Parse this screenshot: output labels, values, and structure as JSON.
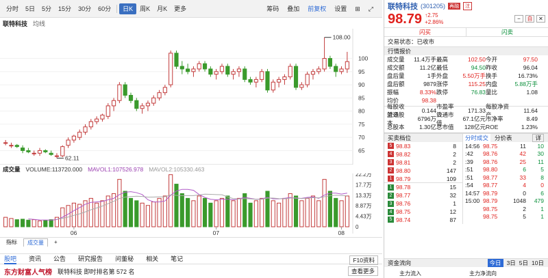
{
  "toolbar": {
    "items": [
      "分时",
      "5日",
      "5分",
      "15分",
      "30分",
      "60分",
      "日K",
      "周K",
      "月K",
      "更多"
    ],
    "active": "日K",
    "right": [
      "筹码",
      "叠加",
      "前复权",
      "设置"
    ]
  },
  "stock": {
    "name": "联特科技",
    "indicator": "均线",
    "code": "(301205)",
    "tag1": "再融",
    "tag2": "注",
    "price": "98.79",
    "change": "2.75",
    "pct": "+2.86%",
    "vol_label": "成交量"
  },
  "chart_data": {
    "type": "candlestick",
    "x_ticks": [
      "06",
      "07",
      "08"
    ],
    "y_ticks": [
      100,
      95,
      90,
      85,
      80,
      75,
      70,
      65
    ],
    "max_label": "108.00",
    "min_label": "62.11",
    "vol_ticks": [
      "22.2万",
      "17.7万",
      "13.3万",
      "8.87万",
      "4.43万",
      "0"
    ],
    "ohlc": [
      [
        68,
        69,
        67,
        68
      ],
      [
        67,
        68,
        66,
        67
      ],
      [
        67,
        67.5,
        66,
        66.5
      ],
      [
        66,
        67,
        64,
        65
      ],
      [
        65,
        66,
        64,
        64.5
      ],
      [
        64,
        65,
        63,
        64
      ],
      [
        64,
        66,
        63,
        65
      ],
      [
        65,
        65.5,
        64,
        64.5
      ],
      [
        64,
        65,
        63,
        63.5
      ],
      [
        63,
        64,
        62.11,
        63
      ],
      [
        63,
        67,
        62.5,
        66.5
      ],
      [
        67,
        70,
        66,
        69
      ],
      [
        69,
        71,
        68,
        70.5
      ],
      [
        70,
        73,
        69,
        72
      ],
      [
        72,
        75,
        71,
        74
      ],
      [
        74,
        77,
        73,
        76
      ],
      [
        76,
        78,
        75,
        77
      ],
      [
        77,
        79,
        76,
        78.5
      ],
      [
        78,
        83,
        77,
        82
      ],
      [
        82,
        85,
        80,
        84
      ],
      [
        84,
        91,
        83,
        90
      ],
      [
        90,
        91,
        85,
        86
      ],
      [
        86,
        87,
        83,
        84
      ],
      [
        84,
        85,
        80,
        81
      ],
      [
        81,
        83,
        79,
        82
      ],
      [
        82,
        84,
        80,
        83
      ],
      [
        83,
        86,
        82,
        85
      ],
      [
        85,
        88,
        84,
        87
      ],
      [
        87,
        90,
        86,
        89
      ],
      [
        90,
        103,
        89,
        102
      ],
      [
        102,
        103,
        96,
        97
      ],
      [
        97,
        99,
        94,
        96
      ],
      [
        96,
        98,
        94,
        95
      ],
      [
        95,
        97,
        93,
        96
      ],
      [
        96,
        99,
        95,
        98
      ],
      [
        98,
        99,
        95,
        96
      ],
      [
        96,
        97,
        93,
        94
      ],
      [
        94,
        96,
        92,
        95
      ],
      [
        95,
        98,
        94,
        97
      ],
      [
        97,
        98,
        93,
        94
      ],
      [
        94,
        96,
        92,
        95
      ],
      [
        95,
        97,
        93,
        96
      ],
      [
        96,
        97,
        91,
        92
      ],
      [
        92,
        93,
        90,
        91
      ],
      [
        91,
        93,
        89,
        92
      ],
      [
        92,
        96,
        91,
        95
      ],
      [
        95,
        96,
        87,
        88
      ],
      [
        88,
        92,
        87,
        91
      ],
      [
        91,
        93,
        89,
        92
      ],
      [
        92,
        94,
        90,
        93
      ],
      [
        93,
        98,
        92,
        97
      ],
      [
        97,
        98,
        88,
        89
      ],
      [
        89,
        91,
        88,
        90
      ],
      [
        90,
        95,
        89,
        94
      ],
      [
        94,
        96,
        92,
        95
      ],
      [
        95,
        97,
        94,
        96
      ],
      [
        96,
        108,
        95,
        100
      ],
      [
        100,
        101,
        96,
        97
      ],
      [
        97,
        98,
        93,
        95
      ],
      [
        95,
        97,
        94,
        96
      ],
      [
        96,
        102.5,
        94.5,
        98.79
      ]
    ],
    "volume": [
      4,
      3.5,
      3,
      3.2,
      2.8,
      3,
      2.5,
      2.7,
      3,
      4,
      8,
      9,
      10,
      9.5,
      11,
      12,
      10,
      11,
      13,
      14,
      20,
      15,
      12,
      11,
      10,
      9,
      10.5,
      12,
      13,
      22,
      18,
      14,
      12,
      11,
      13,
      12,
      10,
      11,
      12,
      13,
      11,
      12,
      14,
      10,
      11,
      12,
      15,
      11,
      10,
      12,
      14,
      13,
      11,
      12,
      13,
      11,
      20,
      15,
      12,
      11,
      13
    ],
    "ma_volume": "MAVOL1:107526.978",
    "ma_volume2": "MAVOL2:105330.463",
    "volume_text": "VOLUME:113720.000"
  },
  "bottom_tabs": [
    "指标",
    "成交量"
  ],
  "nav": {
    "items": [
      "股吧",
      "资讯",
      "公告",
      "研究报告",
      "问董秘",
      "相关",
      "笔记"
    ],
    "active": "股吧",
    "f10": "F10资料"
  },
  "rank": {
    "logo": "东方财富人气榜",
    "text": "联特科技  即时排名第 572 名",
    "detail": "查看更多"
  },
  "actions": {
    "buy": "闪买",
    "sell": "闪卖"
  },
  "status": "交易状态：已收市",
  "quote_title": "行情报价",
  "quote": [
    [
      "成交量",
      "11.4万手",
      "最高",
      "102.50",
      "今开",
      "97.50"
    ],
    [
      "成交额",
      "11.2亿",
      "最低",
      "94.50",
      "昨收",
      "96.04"
    ],
    [
      "盘后量",
      "1手",
      "外盘",
      "5.50万手",
      "换手",
      "16.73%"
    ],
    [
      "盘后额",
      "9879",
      "涨停",
      "115.25",
      "内盘",
      "5.88万手"
    ],
    [
      "振幅",
      "8.33%",
      "跌停",
      "76.83",
      "量比",
      "1.08"
    ],
    [
      "均价",
      "98.38",
      "",
      "",
      "",
      ""
    ]
  ],
  "fin": [
    [
      "每股收益⊙",
      "0.144",
      "市盈率⊙",
      "171.33",
      "每股净资产",
      "11.64"
    ],
    [
      "流通股本",
      "6796万",
      "流通市值",
      "67.1亿元",
      "市净率",
      "8.49"
    ],
    [
      "总股本",
      "1.30亿",
      "总市值",
      "128亿元",
      "ROE",
      "1.23%"
    ]
  ],
  "orderbook_title": "买卖档位",
  "sells": [
    [
      "5",
      "98.83",
      "8"
    ],
    [
      "4",
      "98.82",
      "2"
    ],
    [
      "3",
      "98.81",
      "2"
    ],
    [
      "2",
      "98.80",
      "147"
    ],
    [
      "1",
      "98.79",
      "109"
    ]
  ],
  "buys": [
    [
      "1",
      "98.78",
      "15"
    ],
    [
      "2",
      "98.77",
      "32"
    ],
    [
      "3",
      "98.76",
      "1"
    ],
    [
      "4",
      "98.75",
      "12"
    ],
    [
      "5",
      "98.74",
      "87"
    ]
  ],
  "ticks_tabs": [
    "分时成交",
    "分价表",
    "详"
  ],
  "ticks": [
    [
      "14:56",
      "98.75",
      "11",
      "10"
    ],
    [
      ":42",
      "98.76",
      "42",
      "30"
    ],
    [
      ":39",
      "98.76",
      "25",
      "11"
    ],
    [
      ":51",
      "98.80",
      "6",
      "5"
    ],
    [
      ":51",
      "98.77",
      "33",
      "8"
    ],
    [
      ":54",
      "98.77",
      "4",
      "0"
    ],
    [
      "14:57",
      "98.79",
      "0",
      "6"
    ],
    [
      "15:00",
      "98.79",
      "1048",
      "479"
    ],
    [
      "",
      "98.75",
      "2",
      "1"
    ],
    [
      "",
      "98.75",
      "5",
      "1"
    ]
  ],
  "funds": {
    "title": "资金流向",
    "tabs": [
      "今日",
      "3日",
      "5日",
      "10日"
    ],
    "in": "主力流入",
    "net": "主力净流向"
  }
}
